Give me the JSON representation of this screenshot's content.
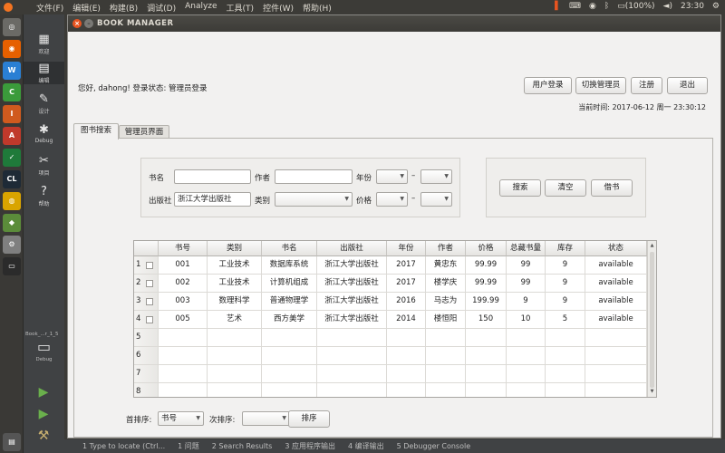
{
  "system_bar": {
    "menus": [
      "文件(F)",
      "编辑(E)",
      "构建(B)",
      "调试(D)",
      "Analyze",
      "工具(T)",
      "控件(W)",
      "帮助(H)"
    ],
    "battery": "(100%)",
    "time": "23:30"
  },
  "qt_modes": [
    {
      "label": "欢迎",
      "icon": "grid-icon"
    },
    {
      "label": "编辑",
      "icon": "edit-icon"
    },
    {
      "label": "设计",
      "icon": "pencil-icon"
    },
    {
      "label": "Debug",
      "icon": "bug-icon"
    },
    {
      "label": "项目",
      "icon": "wrench-icon"
    },
    {
      "label": "帮助",
      "icon": "help-icon"
    }
  ],
  "qt_kit": {
    "project": "Book_...r_1_5",
    "label": "Debug"
  },
  "output_tabs": [
    "1  Type to locate (Ctrl...",
    "1  问题",
    "2  Search Results",
    "3  应用程序输出",
    "4  编译输出",
    "5  Debugger Console"
  ],
  "window": {
    "title": "BOOK MANAGER"
  },
  "header": {
    "greeting": "您好, dahong! 登录状态: 管理员登录",
    "buttons": [
      "用户登录",
      "切换管理员",
      "注册",
      "退出"
    ],
    "clock": "当前时间: 2017-06-12 周一 23:30:12"
  },
  "tabs": [
    "图书搜索",
    "管理员界面"
  ],
  "search": {
    "labels": {
      "title": "书名",
      "author": "作者",
      "year": "年份",
      "publisher": "出版社",
      "category": "类别",
      "price": "价格"
    },
    "publisher_value": "浙江大学出版社",
    "range_sep": "–"
  },
  "actions": [
    "搜索",
    "清空",
    "借书"
  ],
  "table": {
    "columns": [
      "书号",
      "类别",
      "书名",
      "出版社",
      "年份",
      "作者",
      "价格",
      "总藏书量",
      "库存",
      "状态"
    ],
    "rows": [
      {
        "n": "1",
        "cells": [
          "001",
          "工业技术",
          "数据库系统",
          "浙江大学出版社",
          "2017",
          "黄忠东",
          "99.99",
          "99",
          "9",
          "available"
        ]
      },
      {
        "n": "2",
        "cells": [
          "002",
          "工业技术",
          "计算机组成",
          "浙江大学出版社",
          "2017",
          "楼学庆",
          "99.99",
          "99",
          "9",
          "available"
        ]
      },
      {
        "n": "3",
        "cells": [
          "003",
          "数理科学",
          "普通物理学",
          "浙江大学出版社",
          "2016",
          "马志为",
          "199.99",
          "9",
          "9",
          "available"
        ]
      },
      {
        "n": "4",
        "cells": [
          "005",
          "艺术",
          "西方美学",
          "浙江大学出版社",
          "2014",
          "楼恒阳",
          "150",
          "10",
          "5",
          "available"
        ]
      },
      {
        "n": "5",
        "cells": [
          "",
          "",
          "",
          "",
          "",
          "",
          "",
          "",
          "",
          ""
        ]
      },
      {
        "n": "6",
        "cells": [
          "",
          "",
          "",
          "",
          "",
          "",
          "",
          "",
          "",
          ""
        ]
      },
      {
        "n": "7",
        "cells": [
          "",
          "",
          "",
          "",
          "",
          "",
          "",
          "",
          "",
          ""
        ]
      },
      {
        "n": "8",
        "cells": [
          "",
          "",
          "",
          "",
          "",
          "",
          "",
          "",
          "",
          ""
        ]
      }
    ]
  },
  "sort": {
    "primary_label": "首排序:",
    "primary_value": "书号",
    "secondary_label": "次排序:",
    "secondary_value": "",
    "button": "排序"
  },
  "colors": {
    "accent": "#e95420",
    "panel": "#3c3b37",
    "window_bg": "#f2f1f0"
  }
}
